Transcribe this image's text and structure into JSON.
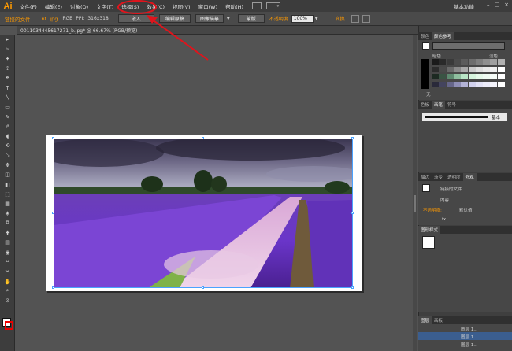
{
  "app": {
    "logo": "Ai"
  },
  "menu": [
    "文件(F)",
    "编辑(E)",
    "对象(O)",
    "文字(T)",
    "选择(S)",
    "效果(C)",
    "视图(V)",
    "窗口(W)",
    "帮助(H)"
  ],
  "workspace": "基本功能",
  "window_controls": [
    "–",
    "□",
    "×"
  ],
  "control_bar": {
    "linked_file": "链接的文件",
    "file_name": "nt..jpg",
    "color_mode": "RGB",
    "ppi_label": "PPI:",
    "ppi_value": "316x318",
    "embed_button": "嵌入",
    "edit_original_button": "编辑原稿",
    "image_trace_button": "图像描摹",
    "mask_button": "蒙版",
    "opacity_label": "不透明度",
    "opacity_value": "100%",
    "transform_label": "变换"
  },
  "document": {
    "tab": "0011034445617271_b.jpg* @ 66.67% (RGB/预览)"
  },
  "tools": [
    "▸",
    "▹",
    "✦",
    "⟟",
    "✒",
    "T",
    "╲",
    "▭",
    "✎",
    "✐",
    "◖",
    "⟲",
    "⤡",
    "✥",
    "◫",
    "◧",
    "⬚",
    "▦",
    "◈",
    "⧉",
    "✚",
    "▤",
    "◉",
    "⌗",
    "✂",
    "✋",
    "⌕",
    "⊘"
  ],
  "panels": {
    "color_tabs": [
      "颜色",
      "颜色参考"
    ],
    "color_left_label": "暗色",
    "color_right_label": "淡色",
    "color_none": "无",
    "stroke_tabs": [
      "色板",
      "画笔",
      "符号"
    ],
    "brush_label": "基本",
    "appearance_tabs": [
      "描边",
      "渐变",
      "透明度",
      "外观"
    ],
    "appearance_linked": "链接的文件",
    "appearance_content": "内容",
    "appearance_opacity_label": "不透明度:",
    "appearance_opacity_value": "默认值",
    "appearance_fx": "fx.",
    "graphic_styles_tab": "图形样式",
    "layers_tabs": [
      "图层",
      "画板"
    ],
    "layers": [
      "图层 1...",
      "图层 1...",
      "图层 1..."
    ]
  },
  "colors": {
    "accent": "#ff9a00",
    "annotation": "#e0141c",
    "selection": "#4aa3ff"
  }
}
